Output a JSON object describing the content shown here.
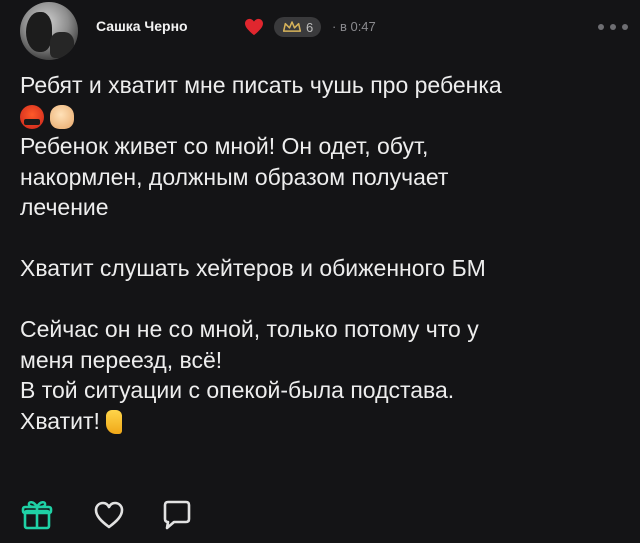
{
  "post": {
    "author": "Сашка Черно",
    "badge_count": "6",
    "time": "· в 0:47",
    "lines": [
      "Ребят и хватит мне писать чушь про ребенка",
      "Ребенок живет со мной! Он одет, обут,",
      "накормлен, должным образом получает",
      "лечение",
      "Хватит слушать хейтеров и обиженного БМ",
      "Сейчас он не со мной, только потому что у",
      "меня переезд, всё!",
      "В той ситуации с опекой-была подстава.",
      "Хватит!"
    ]
  },
  "icons": {
    "heart": "heart-icon",
    "badge": "crown-icon",
    "more": "more-icon",
    "gift": "gift-icon",
    "like": "like-icon",
    "comment": "comment-icon",
    "emoji_1": "angry-face-emoji",
    "emoji_2": "ok-hand-emoji",
    "emoji_3": "nail-polish-emoji"
  },
  "colors": {
    "background": "#141416",
    "text": "#ececec",
    "heart": "#e0262e",
    "badge_accent": "#d8b45a",
    "muted": "#8a8a8e"
  }
}
